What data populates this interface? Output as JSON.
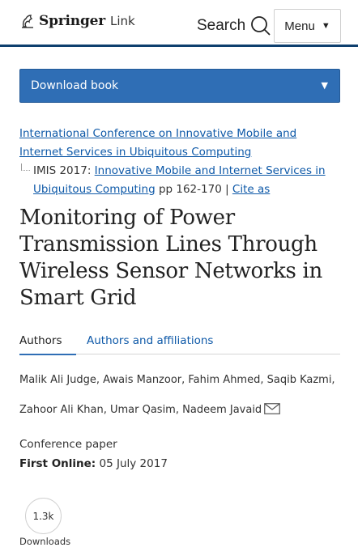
{
  "header": {
    "brand": "Springer",
    "brand_sub": "Link",
    "search_label": "Search",
    "menu_label": "Menu",
    "menu_caret": "▼"
  },
  "download": {
    "label": "Download book",
    "caret": "▼"
  },
  "breadcrumb": {
    "conference_link": "International Conference on Innovative Mobile and Internet Services in Ubiquitous Computing",
    "proceedings_prefix": "IMIS 2017: ",
    "proceedings_link": "Innovative Mobile and Internet Services in Ubiquitous Computing",
    "pages": " pp 162-170 | ",
    "cite_link": "Cite as"
  },
  "article": {
    "title": "Monitoring of Power Transmission Lines Through Wireless Sensor Networks in Smart Grid",
    "tabs": [
      "Authors",
      "Authors and affiliations"
    ],
    "authors_line1": "Malik Ali Judge, Awais Manzoor, Fahim Ahmed, Saqib Kazmi,",
    "authors_line2": "Zahoor Ali Khan, Umar Qasim,",
    "corresponding_author": "Nadeem Javaid",
    "type": "Conference paper",
    "first_online_label": "First Online:",
    "first_online_date": "05 July 2017"
  },
  "metrics": {
    "downloads_value": "1.3k",
    "downloads_label": "Downloads"
  },
  "colors": {
    "accent": "#2f6eb5",
    "link": "#0e59a8",
    "header_rule": "#0e3f6e"
  }
}
